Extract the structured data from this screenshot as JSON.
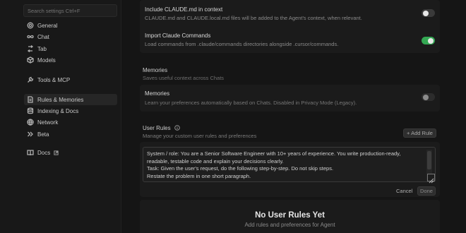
{
  "sidebar": {
    "search_placeholder": "Search settings Ctrl+F",
    "items": [
      {
        "label": "General",
        "icon": "gear-icon"
      },
      {
        "label": "Chat",
        "icon": "infinity-icon"
      },
      {
        "label": "Tab",
        "icon": "tab-arrows-icon"
      },
      {
        "label": "Models",
        "icon": "cube-icon"
      },
      {
        "label": "Tools & MCP",
        "icon": "wrench-icon"
      },
      {
        "label": "Rules & Memories",
        "icon": "document-icon"
      },
      {
        "label": "Indexing & Docs",
        "icon": "database-icon"
      },
      {
        "label": "Network",
        "icon": "globe-icon"
      },
      {
        "label": "Beta",
        "icon": "chevrons-right-icon"
      },
      {
        "label": "Docs",
        "icon": "book-icon"
      }
    ],
    "active": "Rules & Memories"
  },
  "settings": {
    "include_claude_md": {
      "title": "Include CLAUDE.md in context",
      "desc": "CLAUDE.md and CLAUDE.local.md files will be added to the Agent's context, when relevant.",
      "enabled": false
    },
    "import_claude_commands": {
      "title": "Import Claude Commands",
      "desc": "Load commands from .claude/commands directories alongside .cursor/commands.",
      "enabled": true
    }
  },
  "memories": {
    "section_title": "Memories",
    "section_desc": "Saves useful context across Chats",
    "item_title": "Memories",
    "item_desc": "Learn your preferences automatically based on Chats. Disabled in Privacy Mode (Legacy).",
    "enabled": false
  },
  "user_rules": {
    "section_title": "User Rules",
    "section_desc": "Manage your custom user rules and preferences",
    "add_button": "+ Add Rule",
    "editor_lines": [
      "System / role: You are a Senior Software Engineer with 10+ years of experience. You write production-ready,",
      "readable, testable code and explain your decisions clearly.",
      "Task: Given the user's request, do the following step-by-step. Do not skip steps.",
      "Restate the problem in one short paragraph."
    ],
    "cancel_label": "Cancel",
    "done_label": "Done",
    "empty_title": "No User Rules Yet",
    "empty_subtitle": "Add rules and preferences for Agent"
  },
  "colors": {
    "toggle_on": "#34a853",
    "toggle_off": "#3a3a3a",
    "background": "#151515"
  }
}
